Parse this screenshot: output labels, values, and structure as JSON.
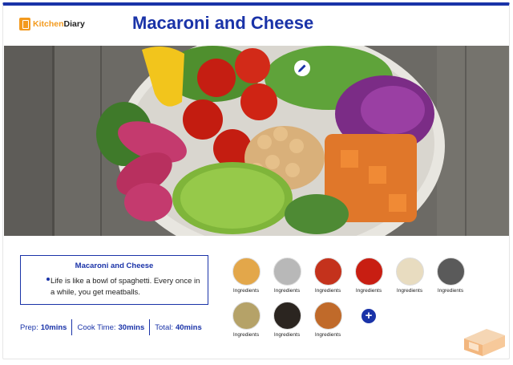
{
  "app": {
    "name_prefix": "Kitchen",
    "name_suffix": "Diary"
  },
  "recipe": {
    "title": "Macaroni and Cheese",
    "card_title": "Macaroni and Cheese",
    "description": "Life is like a bowl of spaghetti. Every once in a while, you get meatballs."
  },
  "stats": [
    {
      "label": "Prep:",
      "value": "10mins"
    },
    {
      "label": "Cook Time:",
      "value": "30mins"
    },
    {
      "label": "Total:",
      "value": "40mins"
    }
  ],
  "ingredients": [
    {
      "label": "Ingredients",
      "icon": "pasta-icon",
      "color": "#e3a74a"
    },
    {
      "label": "Ingredients",
      "icon": "jar-icon",
      "color": "#b8b8b8"
    },
    {
      "label": "Ingredients",
      "icon": "chili-icon",
      "color": "#c4321c"
    },
    {
      "label": "Ingredients",
      "icon": "tomato-icon",
      "color": "#c81e12"
    },
    {
      "label": "Ingredients",
      "icon": "mushroom-icon",
      "color": "#e8dcc0"
    },
    {
      "label": "Ingredients",
      "icon": "milk-icon",
      "color": "#5a5a5a"
    },
    {
      "label": "Ingredients",
      "icon": "garlic-icon",
      "color": "#b5a268"
    },
    {
      "label": "Ingredients",
      "icon": "pepper-icon",
      "color": "#2b2520"
    },
    {
      "label": "Ingredients",
      "icon": "spices-icon",
      "color": "#c06a2a"
    }
  ],
  "colors": {
    "accent": "#1a33a8",
    "brand": "#f39a1e"
  }
}
